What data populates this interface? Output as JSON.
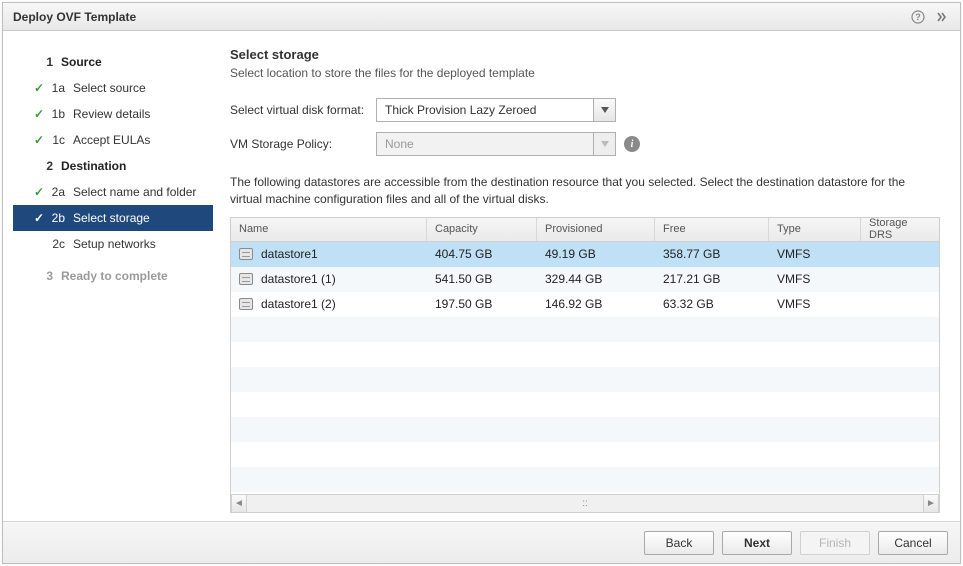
{
  "window": {
    "title": "Deploy OVF Template"
  },
  "sidebar": {
    "s1": {
      "num": "1",
      "label": "Source"
    },
    "s1a": {
      "num": "1a",
      "label": "Select source"
    },
    "s1b": {
      "num": "1b",
      "label": "Review details"
    },
    "s1c": {
      "num": "1c",
      "label": "Accept EULAs"
    },
    "s2": {
      "num": "2",
      "label": "Destination"
    },
    "s2a": {
      "num": "2a",
      "label": "Select name and folder"
    },
    "s2b": {
      "num": "2b",
      "label": "Select storage"
    },
    "s2c": {
      "num": "2c",
      "label": "Setup networks"
    },
    "s3": {
      "num": "3",
      "label": "Ready to complete"
    }
  },
  "content": {
    "title": "Select storage",
    "desc": "Select location to store the files for the deployed template",
    "disk_format_label": "Select virtual disk format:",
    "disk_format_value": "Thick Provision Lazy Zeroed",
    "policy_label": "VM Storage Policy:",
    "policy_value": "None",
    "table_desc": "The following datastores are accessible from the destination resource that you selected. Select the destination datastore for the virtual machine configuration files and all of the virtual disks."
  },
  "table": {
    "headers": {
      "name": "Name",
      "capacity": "Capacity",
      "provisioned": "Provisioned",
      "free": "Free",
      "type": "Type",
      "drs": "Storage DRS"
    },
    "rows": [
      {
        "name": "datastore1",
        "capacity": "404.75 GB",
        "provisioned": "49.19 GB",
        "free": "358.77 GB",
        "type": "VMFS",
        "drs": ""
      },
      {
        "name": "datastore1 (1)",
        "capacity": "541.50 GB",
        "provisioned": "329.44 GB",
        "free": "217.21 GB",
        "type": "VMFS",
        "drs": ""
      },
      {
        "name": "datastore1 (2)",
        "capacity": "197.50 GB",
        "provisioned": "146.92 GB",
        "free": "63.32 GB",
        "type": "VMFS",
        "drs": ""
      }
    ]
  },
  "footer": {
    "back": "Back",
    "next": "Next",
    "finish": "Finish",
    "cancel": "Cancel"
  }
}
